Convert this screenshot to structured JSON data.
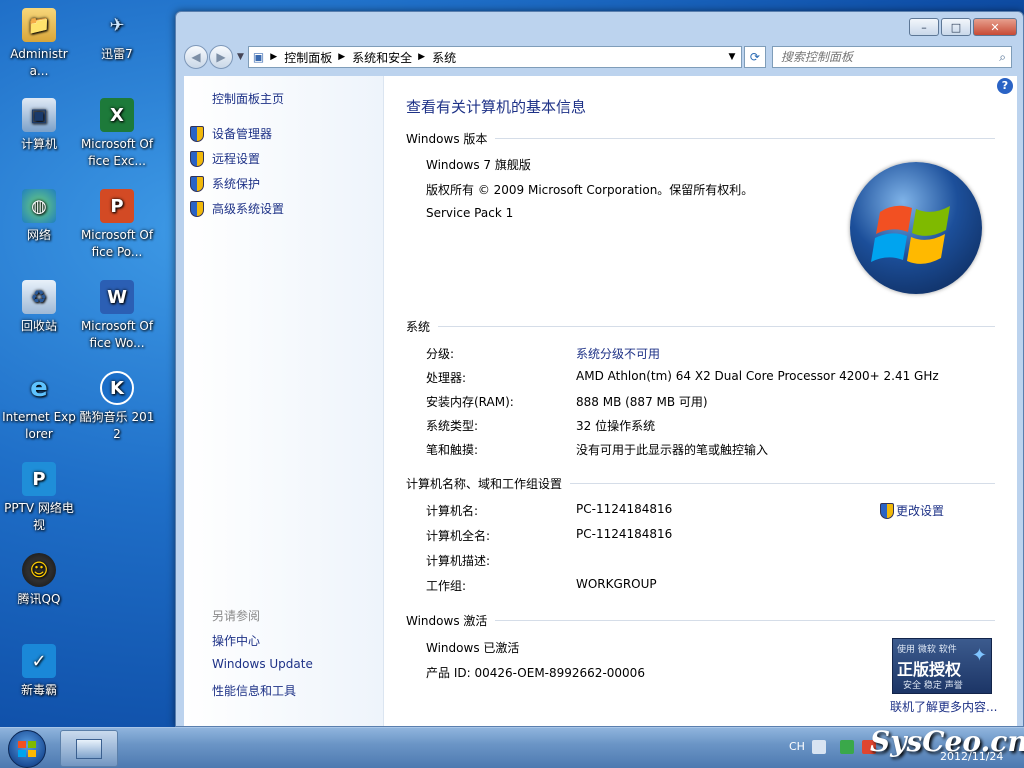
{
  "desktop": {
    "icons": [
      {
        "label": "Administra...",
        "icon": "folder-user-icon"
      },
      {
        "label": "迅雷7",
        "icon": "thunder-icon"
      },
      {
        "label": "计算机",
        "icon": "computer-icon"
      },
      {
        "label": "Microsoft Office Exc...",
        "icon": "excel-icon"
      },
      {
        "label": "网络",
        "icon": "network-icon"
      },
      {
        "label": "Microsoft Office Po...",
        "icon": "powerpoint-icon"
      },
      {
        "label": "回收站",
        "icon": "recycle-bin-icon"
      },
      {
        "label": "Microsoft Office Wo...",
        "icon": "word-icon"
      },
      {
        "label": "Internet Explorer",
        "icon": "ie-icon"
      },
      {
        "label": "酷狗音乐 2012",
        "icon": "kugou-icon"
      },
      {
        "label": "PPTV 网络电视",
        "icon": "pptv-icon"
      },
      {
        "label": "腾讯QQ",
        "icon": "qq-icon"
      },
      {
        "label": "新毒霸",
        "icon": "duba-icon"
      }
    ]
  },
  "window": {
    "controls": {
      "minimize": "–",
      "maximize": "□",
      "close": "✕"
    }
  },
  "address_bar": {
    "crumbs": [
      "控制面板",
      "系统和安全",
      "系统"
    ],
    "search_placeholder": "搜索控制面板"
  },
  "sidebar": {
    "home": "控制面板主页",
    "links": [
      "设备管理器",
      "远程设置",
      "系统保护",
      "高级系统设置"
    ],
    "see_also_title": "另请参阅",
    "see_also_links": [
      "操作中心",
      "Windows Update",
      "性能信息和工具"
    ]
  },
  "main": {
    "title": "查看有关计算机的基本信息",
    "edition": {
      "header": "Windows 版本",
      "name": "Windows 7 旗舰版",
      "copyright": "版权所有 © 2009 Microsoft Corporation。保留所有权利。",
      "service_pack": "Service Pack 1"
    },
    "system": {
      "header": "系统",
      "rows": [
        {
          "label": "分级:",
          "value": "系统分级不可用"
        },
        {
          "label": "处理器:",
          "value": "AMD Athlon(tm) 64 X2 Dual Core Processor 4200+   2.41 GHz"
        },
        {
          "label": "安装内存(RAM):",
          "value": "888 MB (887 MB 可用)"
        },
        {
          "label": "系统类型:",
          "value": "32 位操作系统"
        },
        {
          "label": "笔和触摸:",
          "value": "没有可用于此显示器的笔或触控输入"
        }
      ]
    },
    "computer_name": {
      "header": "计算机名称、域和工作组设置",
      "change_settings": "更改设置",
      "rows": [
        {
          "label": "计算机名:",
          "value": "PC-1124184816"
        },
        {
          "label": "计算机全名:",
          "value": "PC-1124184816"
        },
        {
          "label": "计算机描述:",
          "value": ""
        },
        {
          "label": "工作组:",
          "value": "WORKGROUP"
        }
      ]
    },
    "activation": {
      "header": "Windows 激活",
      "status": "Windows 已激活",
      "product_id": "产品 ID: 00426-OEM-8992662-00006",
      "badge_line1": "使用 微软 软件",
      "badge_line2": "正版授权",
      "badge_line3": "安全 稳定 声誉",
      "learn_more": "联机了解更多内容..."
    }
  },
  "taskbar": {
    "lang": "CH",
    "date": "2012/11/24",
    "watermark": "SysCeo.cn"
  }
}
